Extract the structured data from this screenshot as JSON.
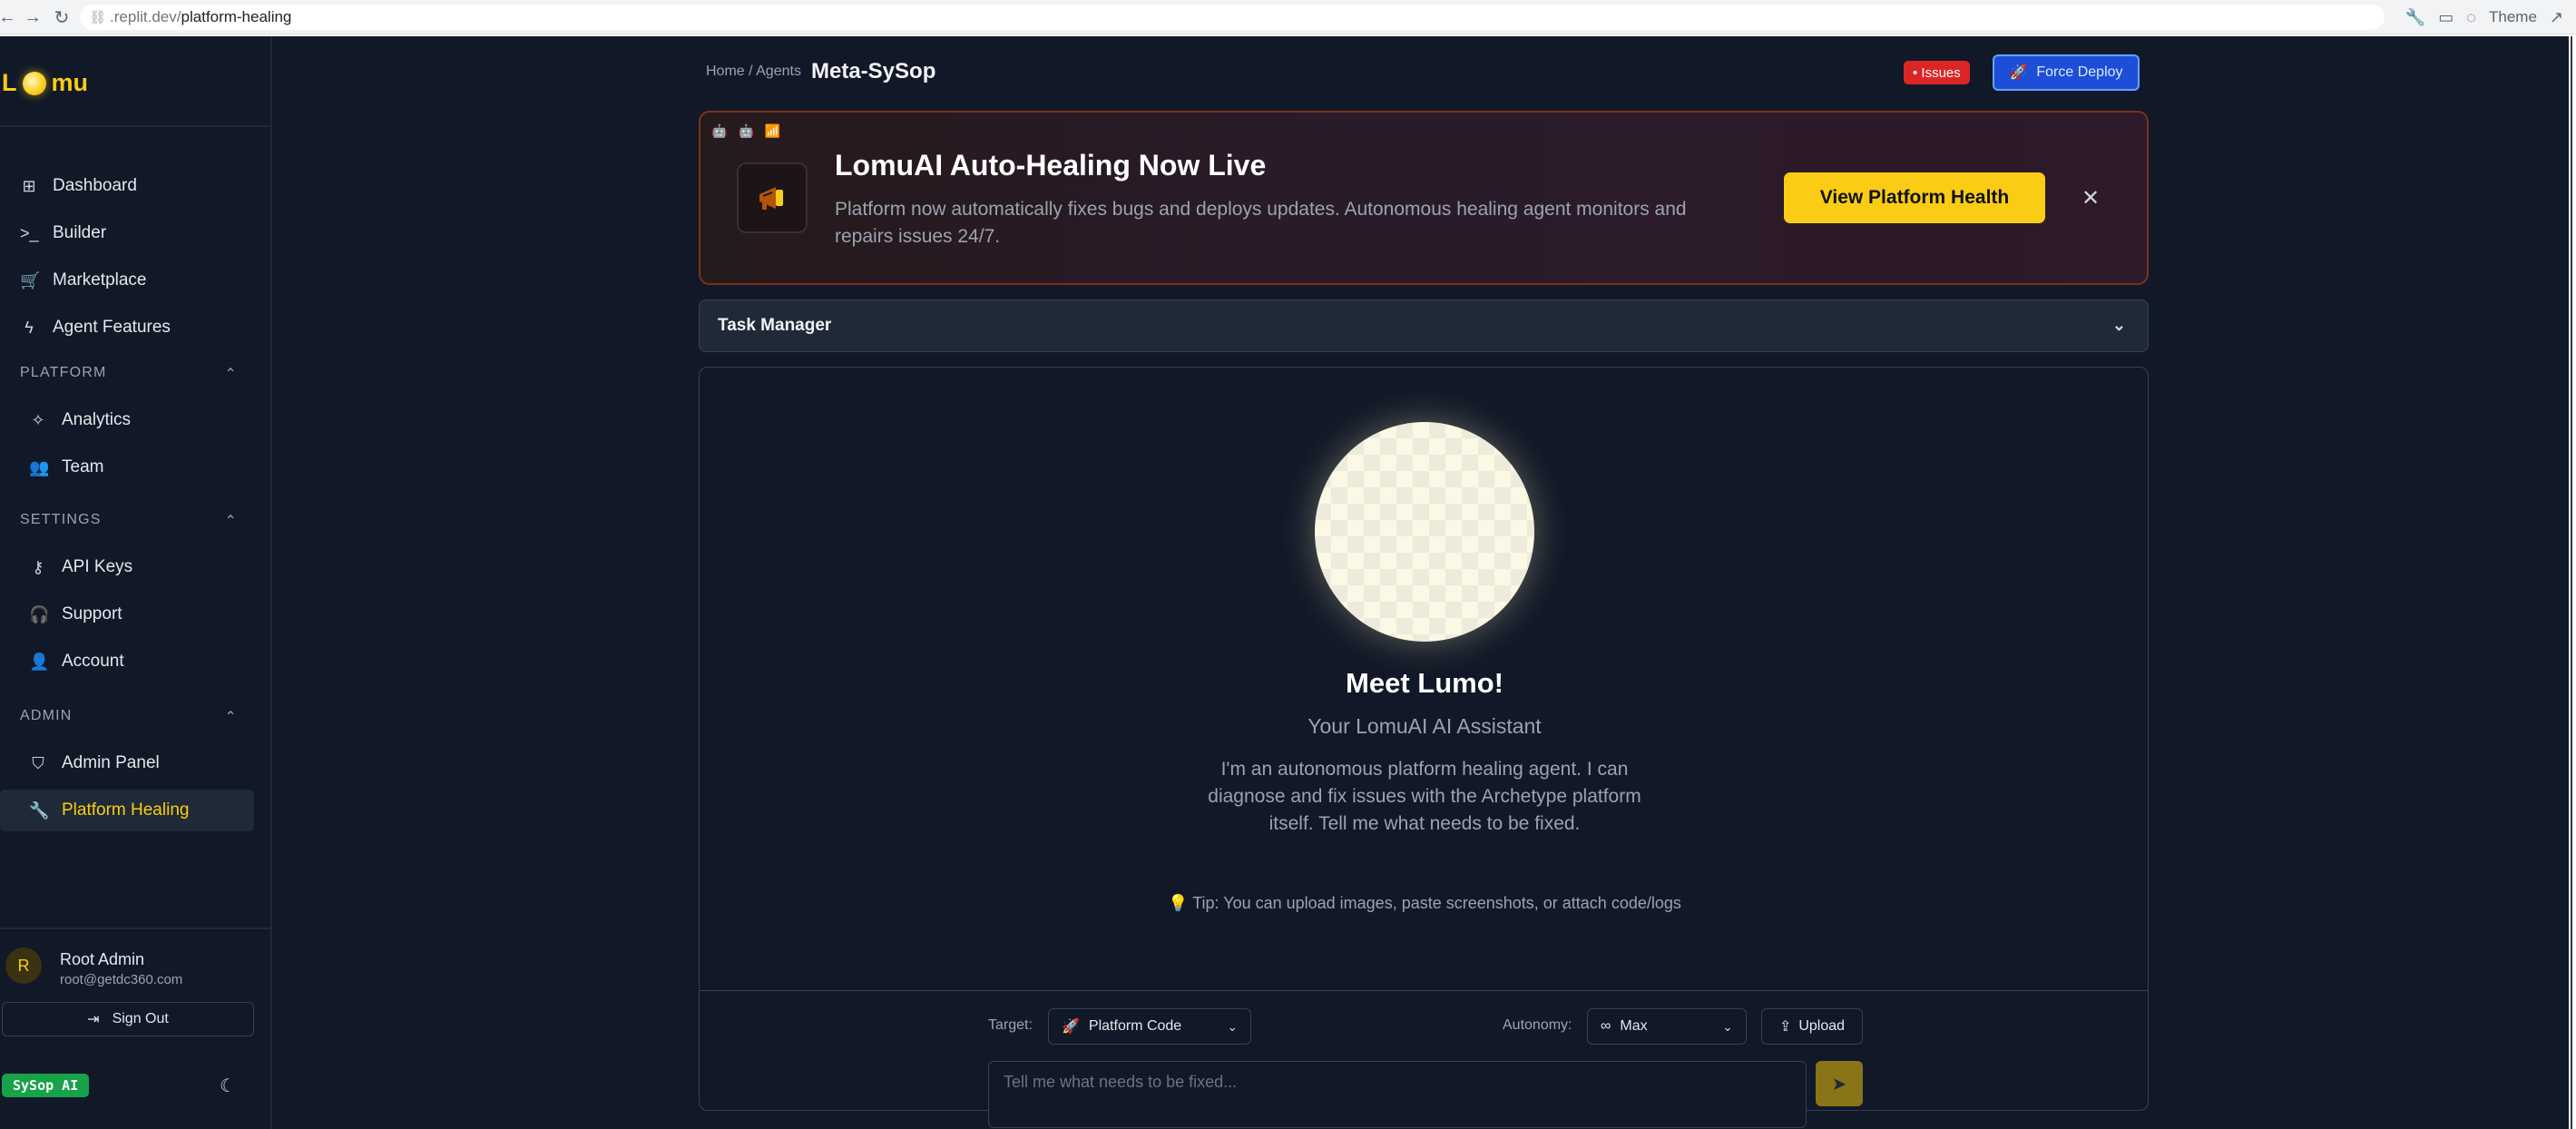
{
  "browser": {
    "url_host": ".replit.dev/",
    "url_path": "platform-healing",
    "theme_label": "Theme"
  },
  "sidebar": {
    "logo_left": "L",
    "logo_right": "mu",
    "items_top": [
      {
        "label": "Dashboard",
        "icon": "dashboard-icon"
      },
      {
        "label": "Builder",
        "icon": "terminal-icon"
      },
      {
        "label": "Marketplace",
        "icon": "cart-icon"
      },
      {
        "label": "Agent Features",
        "icon": "zap-icon"
      }
    ],
    "sections": {
      "platform": {
        "title": "PLATFORM",
        "items": [
          {
            "label": "Analytics",
            "icon": "sparkle-icon"
          },
          {
            "label": "Team",
            "icon": "users-icon"
          }
        ]
      },
      "settings": {
        "title": "SETTINGS",
        "items": [
          {
            "label": "API Keys",
            "icon": "key-icon"
          },
          {
            "label": "Support",
            "icon": "headphones-icon"
          },
          {
            "label": "Account",
            "icon": "user-icon"
          }
        ]
      },
      "admin": {
        "title": "ADMIN",
        "items": [
          {
            "label": "Admin Panel",
            "icon": "shield-icon"
          },
          {
            "label": "Platform Healing",
            "icon": "wrench-icon",
            "active": true
          }
        ]
      }
    },
    "user": {
      "initial": "R",
      "name": "Root Admin",
      "email": "root@getdc360.com"
    },
    "signout_label": "Sign Out",
    "sysop_badge": "SySop AI"
  },
  "header": {
    "breadcrumb": "Home / Agents",
    "title": "Meta-SySop",
    "issues_badge": "• Issues",
    "force_deploy_label": "Force Deploy"
  },
  "banner": {
    "title": "LomuAI Auto-Healing Now Live",
    "description": "Platform now automatically fixes bugs and deploys updates. Autonomous healing agent monitors and repairs issues 24/7.",
    "cta_label": "View Platform Health"
  },
  "task_manager": {
    "title": "Task Manager"
  },
  "chat": {
    "heading": "Meet Lumo!",
    "subtitle": "Your LomuAI AI Assistant",
    "intro": "I'm an autonomous platform healing agent. I can diagnose and fix issues with the Archetype platform itself. Tell me what needs to be fixed.",
    "tip": "💡 Tip: You can upload images, paste screenshots, or attach code/logs",
    "target_label": "Target:",
    "target_value": "Platform Code",
    "autonomy_label": "Autonomy:",
    "autonomy_value": "Max",
    "upload_label": "Upload",
    "input_placeholder": "Tell me what needs to be fixed..."
  },
  "colors": {
    "accent": "#facc15",
    "background": "#111827",
    "danger": "#dc2626",
    "primary": "#1d4ed8",
    "success": "#16a34a"
  }
}
